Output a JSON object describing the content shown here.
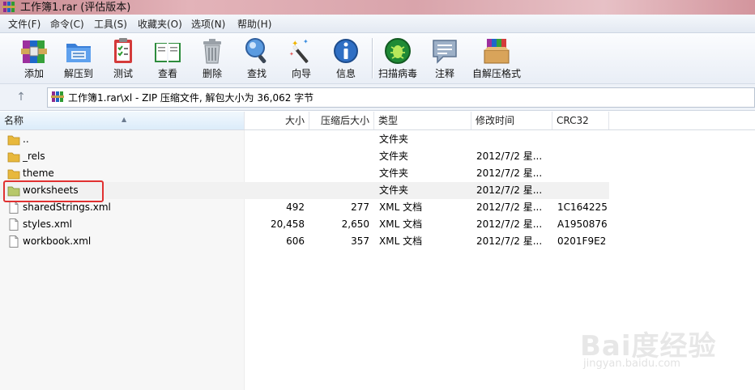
{
  "window": {
    "title": "工作簿1.rar (评估版本)"
  },
  "menu": [
    "文件(F)",
    "命令(C)",
    "工具(S)",
    "收藏夹(O)",
    "选项(N)",
    "帮助(H)"
  ],
  "toolbar": {
    "buttons": [
      {
        "label": "添加",
        "icon": "add-archive-icon"
      },
      {
        "label": "解压到",
        "icon": "extract-to-icon"
      },
      {
        "label": "测试",
        "icon": "test-icon"
      },
      {
        "label": "查看",
        "icon": "view-book-icon"
      },
      {
        "label": "删除",
        "icon": "delete-bin-icon"
      },
      {
        "label": "查找",
        "icon": "find-magnifier-icon"
      },
      {
        "label": "向导",
        "icon": "wizard-wand-icon"
      },
      {
        "label": "信息",
        "icon": "info-icon"
      },
      {
        "label": "扫描病毒",
        "icon": "scan-virus-icon"
      },
      {
        "label": "注释",
        "icon": "comment-icon"
      },
      {
        "label": "自解压格式",
        "icon": "sfx-box-icon"
      }
    ]
  },
  "address": {
    "path": "工作簿1.rar\\xl - ZIP 压缩文件, 解包大小为 36,062 字节"
  },
  "columns": {
    "name": "名称",
    "size": "大小",
    "packed": "压缩后大小",
    "type": "类型",
    "modified": "修改时间",
    "crc": "CRC32"
  },
  "rows": [
    {
      "name": "..",
      "size": "",
      "packed": "",
      "type": "文件夹",
      "modified": "",
      "crc": "",
      "kind": "folder"
    },
    {
      "name": "_rels",
      "size": "",
      "packed": "",
      "type": "文件夹",
      "modified": "2012/7/2 星...",
      "crc": "",
      "kind": "folder"
    },
    {
      "name": "theme",
      "size": "",
      "packed": "",
      "type": "文件夹",
      "modified": "2012/7/2 星...",
      "crc": "",
      "kind": "folder"
    },
    {
      "name": "worksheets",
      "size": "",
      "packed": "",
      "type": "文件夹",
      "modified": "2012/7/2 星...",
      "crc": "",
      "kind": "folder"
    },
    {
      "name": "sharedStrings.xml",
      "size": "492",
      "packed": "277",
      "type": "XML 文档",
      "modified": "2012/7/2 星...",
      "crc": "1C164225",
      "kind": "file"
    },
    {
      "name": "styles.xml",
      "size": "20,458",
      "packed": "2,650",
      "type": "XML 文档",
      "modified": "2012/7/2 星...",
      "crc": "A1950876",
      "kind": "file"
    },
    {
      "name": "workbook.xml",
      "size": "606",
      "packed": "357",
      "type": "XML 文档",
      "modified": "2012/7/2 星...",
      "crc": "0201F9E2",
      "kind": "file"
    }
  ],
  "highlight_color": "#e03131",
  "watermark": {
    "brand": "Bai度经验",
    "url": "jingyan.baidu.com"
  }
}
